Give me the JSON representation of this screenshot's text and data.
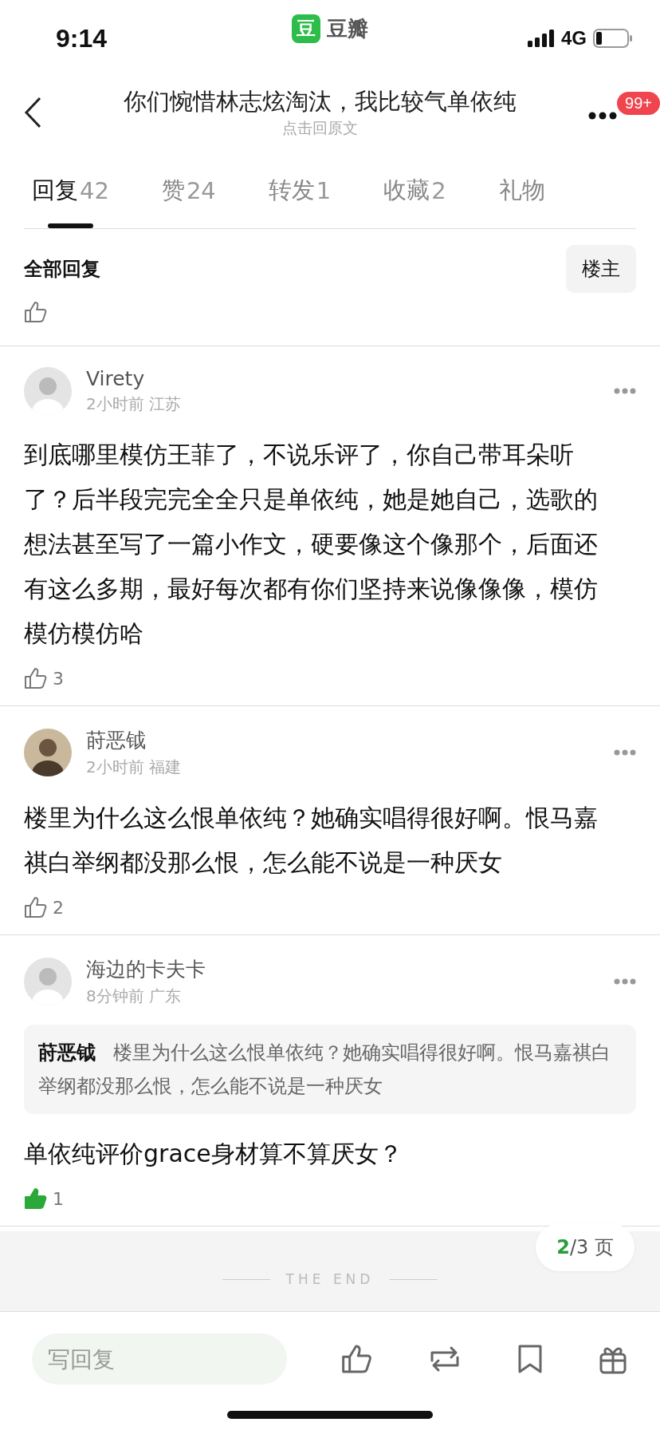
{
  "status_bar": {
    "time": "9:14",
    "app_logo": "豆",
    "app_name": "豆瓣",
    "network": "4G"
  },
  "header": {
    "title": "你们惋惜林志炫淘汰，我比较气单依纯",
    "subtitle": "点击回原文",
    "badge": "99+"
  },
  "tabs": [
    {
      "label": "回复",
      "count": "42",
      "selected": true
    },
    {
      "label": "赞",
      "count": "24",
      "selected": false
    },
    {
      "label": "转发",
      "count": "1",
      "selected": false
    },
    {
      "label": "收藏",
      "count": "2",
      "selected": false
    },
    {
      "label": "礼物",
      "selected": false
    }
  ],
  "section": {
    "title": "全部回复",
    "filter_button": "楼主"
  },
  "comments": [
    {
      "user": "Virety",
      "time": "2小时前",
      "location": "江苏",
      "text": "到底哪里模仿王菲了，不说乐评了，你自己带耳朵听了？后半段完完全全只是单依纯，她是她自己，选歌的想法甚至写了一篇小作文，硬要像这个像那个，后面还有这么多期，最好每次都有你们坚持来说像像像，模仿模仿模仿哈",
      "likes": "3",
      "liked": false
    },
    {
      "user": "莳恶钺",
      "time": "2小时前",
      "location": "福建",
      "text": "楼里为什么这么恨单依纯？她确实唱得很好啊。恨马嘉祺白举纲都没那么恨，怎么能不说是一种厌女",
      "likes": "2",
      "liked": false
    },
    {
      "user": "海边的卡夫卡",
      "time": "8分钟前",
      "location": "广东",
      "quote": "**莳恶钺**  楼里为什么这么恨单依纯？她确实唱得很好啊。恨马嘉祺白举纲都没那么恨，怎么能不说是一种厌女",
      "text": "单依纯评价grace身材算不算厌女？",
      "likes": "1",
      "liked": true
    }
  ],
  "footer": {
    "end_label": "THE END",
    "page_current": "2",
    "page_rest": "/3 页"
  },
  "reply_bar": {
    "placeholder": "写回复"
  }
}
